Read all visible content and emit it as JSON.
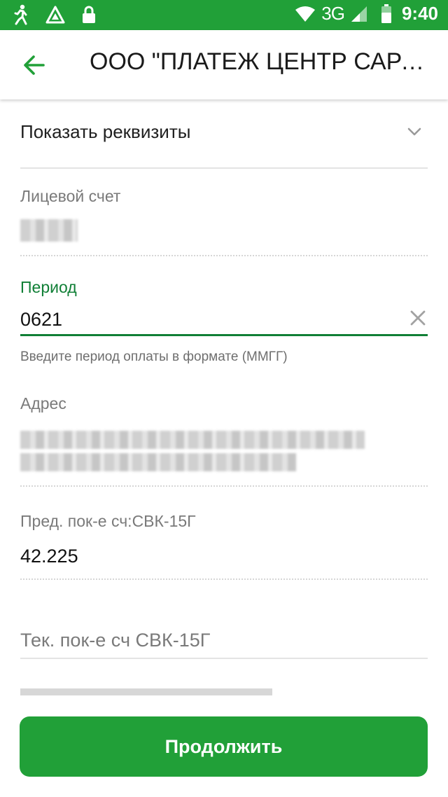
{
  "status_bar": {
    "icons_left": [
      "walk-icon",
      "drive-icon",
      "lock-icon"
    ],
    "network": "3G",
    "time": "9:40"
  },
  "app_bar": {
    "back_icon": "arrow-left-icon",
    "title": "ООО \"ПЛАТЕЖ ЦЕНТР САРА..."
  },
  "form": {
    "requisites_label": "Показать реквизиты",
    "account_label": "Лицевой счет",
    "period_label": "Период",
    "period_value": "0621",
    "period_hint": "Введите период оплаты в формате (ММГГ)",
    "address_label": "Адрес",
    "prev_reading_label": "Пред. пок-е сч:СВК-15Г",
    "prev_reading_value": "42.225",
    "current_reading_placeholder": "Тек. пок-е сч СВК-15Г"
  },
  "actions": {
    "continue_label": "Продолжить"
  },
  "colors": {
    "brand": "#21a038",
    "active_field": "#107f36"
  }
}
